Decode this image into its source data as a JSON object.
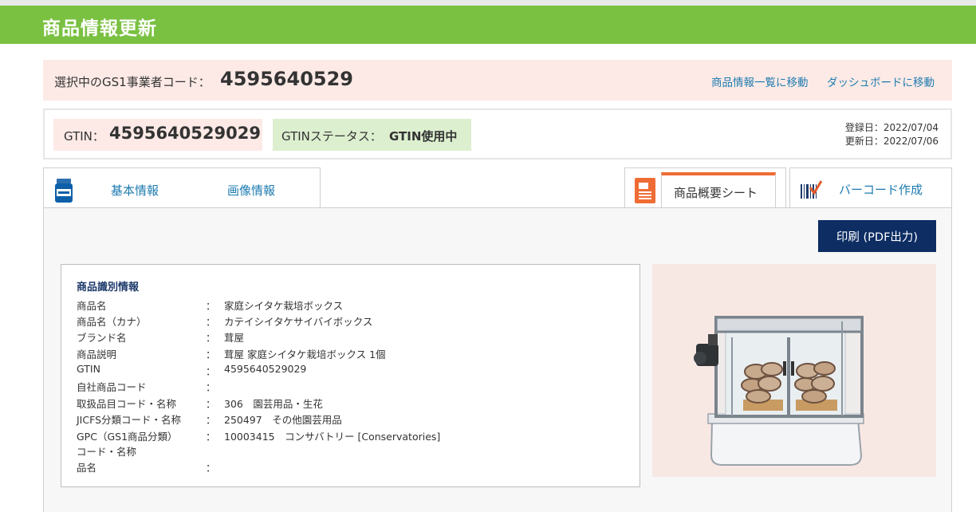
{
  "page": {
    "title": "商品情報更新"
  },
  "company": {
    "label": "選択中のGS1事業者コード：",
    "code": "4595640529",
    "link_list": "商品情報一覧に移動",
    "link_dashboard": "ダッシュボードに移動"
  },
  "gtin": {
    "label": "GTIN：",
    "value": "4595640529029",
    "status_label": "GTINステータス：",
    "status_value": "GTIN使用中",
    "registered": "登録日：2022/07/04",
    "updated": "更新日：2022/07/06"
  },
  "tabs": {
    "basic": "基本情報",
    "image": "画像情報",
    "summary_sheet": "商品概要シート",
    "barcode": "バーコード作成"
  },
  "actions": {
    "print": "印刷 (PDF出力)"
  },
  "product": {
    "section_title": "商品識別情報",
    "colon": "：",
    "rows": [
      {
        "key": "商品名",
        "value": "家庭シイタケ栽培ボックス"
      },
      {
        "key": "商品名（カナ）",
        "value": "カテイシイタケサイバイボックス"
      },
      {
        "key": "ブランド名",
        "value": "茸屋"
      },
      {
        "key": "商品説明",
        "value": "茸屋 家庭シイタケ栽培ボックス 1個"
      },
      {
        "key": "GTIN",
        "value": "4595640529029"
      },
      {
        "key": "自社商品コード",
        "value": ""
      },
      {
        "key": "取扱品目コード・名称",
        "value": "306　園芸用品・生花"
      },
      {
        "key": "JICFS分類コード・名称",
        "value": "250497　その他園芸用品"
      },
      {
        "key": "GPC（GS1商品分類）",
        "value": "10003415　コンサバトリー [Conservatories]"
      }
    ],
    "gpc_line2": "コード・名称",
    "gpc_line3": "品名"
  },
  "colors": {
    "header": "#7ac142",
    "accent_tab": "#ef6c35",
    "print_button": "#0d2d63",
    "link": "#1d7bb0"
  }
}
